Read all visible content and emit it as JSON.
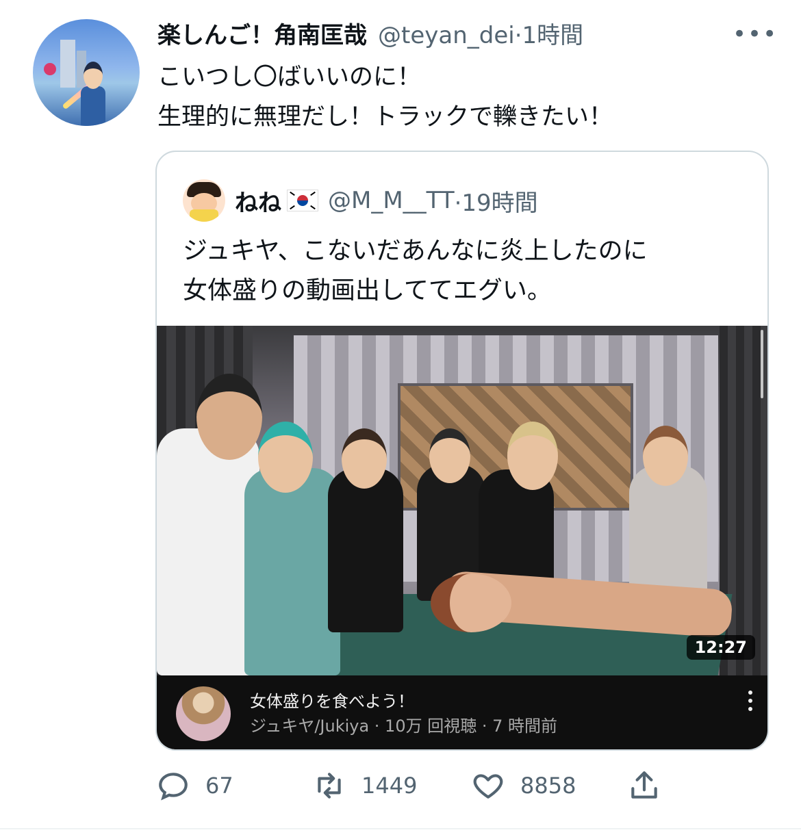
{
  "author": {
    "display_name": "楽しんご！角南匡哉",
    "handle": "@teyan_dei",
    "time": "·1時間"
  },
  "tweet": {
    "lines": [
      "こいつし〇ばいいのに！",
      "生理的に無理だし！トラックで轢きたい！"
    ]
  },
  "more_menu": "•••",
  "quoted": {
    "display_name": "ねね",
    "flag": "KR-flag",
    "handle": "@M_M__TT",
    "time": "·19時間",
    "lines": [
      "ジュキヤ、こないだあんなに炎上したのに",
      "女体盛りの動画出しててエグい。"
    ],
    "video": {
      "duration": "12:27",
      "title": "女体盛りを食べよう！",
      "subtitle": "ジュキヤ/Jukiya · 10万 回視聴 · 7 時間前",
      "more": "⋮"
    }
  },
  "actions": {
    "reply": {
      "icon": "reply-icon",
      "count": "67"
    },
    "retweet": {
      "icon": "retweet-icon",
      "count": "1449"
    },
    "like": {
      "icon": "heart-icon",
      "count": "8858"
    },
    "share": {
      "icon": "share-icon"
    }
  },
  "colors": {
    "text": "#0f1419",
    "secondary": "#536471",
    "border": "#cfd9de",
    "video_bar": "#0f0f0f"
  }
}
